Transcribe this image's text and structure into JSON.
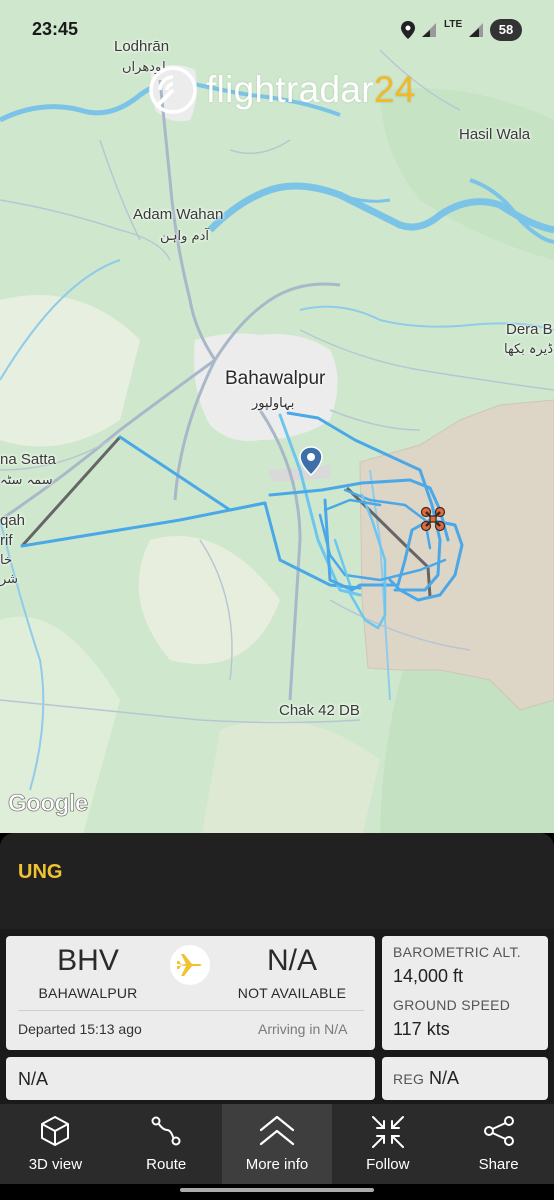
{
  "status_bar": {
    "time": "23:45",
    "network": "LTE",
    "battery": "58",
    "icons": [
      "location-icon",
      "signal-icon",
      "lte-icon",
      "signal-icon-2",
      "battery-icon"
    ]
  },
  "map": {
    "brand": {
      "name_part1": "flightradar",
      "name_part2": "24"
    },
    "attribution": "Google",
    "labels": {
      "lodhran": "Lodhrān",
      "lodhran_urdu": "لودھراں",
      "hasil_wala": "Hasil Wala",
      "adam_wahan": "Adam Wahan",
      "adam_wahan_urdu": "آدم واہن",
      "dera_b": "Dera B",
      "dera_b_urdu": "ڈیرہ بکھا",
      "bahawalpur": "Bahawalpur",
      "bahawalpur_urdu": "بہاولپور",
      "na_satta": "na Satta",
      "na_satta_urdu": "سمہ سٹہ",
      "qah": "qah",
      "rif": "rif",
      "khan_urdu": "خا",
      "sh_urdu": "شر",
      "chak_42": "Chak 42 DB"
    },
    "colors": {
      "land": "#d3ead1",
      "urban": "#ececec",
      "water": "#7cc3e8",
      "track": "#4aa8e8",
      "desert": "#ddd5c6"
    }
  },
  "panel": {
    "callsign": "UNG",
    "origin": {
      "code": "BHV",
      "name": "BAHAWALPUR"
    },
    "destination": {
      "code": "N/A",
      "name": "NOT AVAILABLE"
    },
    "departed": "Departed 15:13 ago",
    "arriving": "Arriving in N/A",
    "barometric_alt_label": "BAROMETRIC ALT.",
    "barometric_alt_value": "14,000 ft",
    "ground_speed_label": "GROUND SPEED",
    "ground_speed_value": "117 kts",
    "aircraft_type": "N/A",
    "reg_label": "REG",
    "reg_value": "N/A",
    "accent_color": "#f1c232"
  },
  "nav": {
    "items": [
      {
        "label": "3D view",
        "icon": "cube-icon"
      },
      {
        "label": "Route",
        "icon": "route-icon"
      },
      {
        "label": "More info",
        "icon": "chevron-up-icon",
        "active": true
      },
      {
        "label": "Follow",
        "icon": "follow-icon"
      },
      {
        "label": "Share",
        "icon": "share-icon"
      }
    ]
  }
}
